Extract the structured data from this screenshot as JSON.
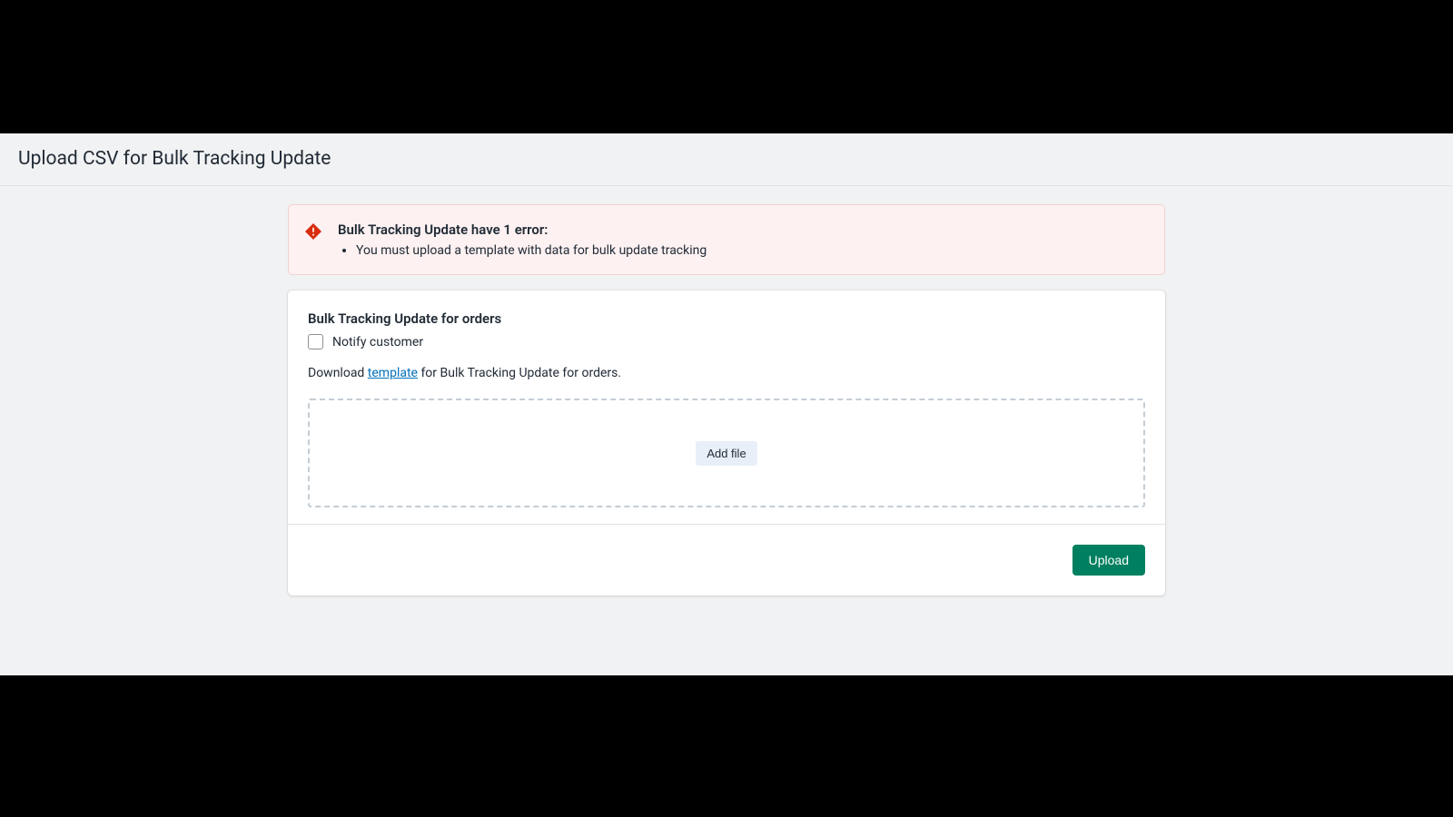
{
  "page": {
    "title": "Upload CSV for Bulk Tracking Update"
  },
  "error_banner": {
    "title": "Bulk Tracking Update have 1 error:",
    "items": [
      "You must upload a template with data for bulk update tracking"
    ]
  },
  "card": {
    "title": "Bulk Tracking Update for orders",
    "notify_label": "Notify customer",
    "download_prefix": "Download ",
    "template_link_text": "template",
    "download_suffix": " for Bulk Tracking Update for orders.",
    "add_file_label": "Add file",
    "upload_button_label": "Upload"
  }
}
